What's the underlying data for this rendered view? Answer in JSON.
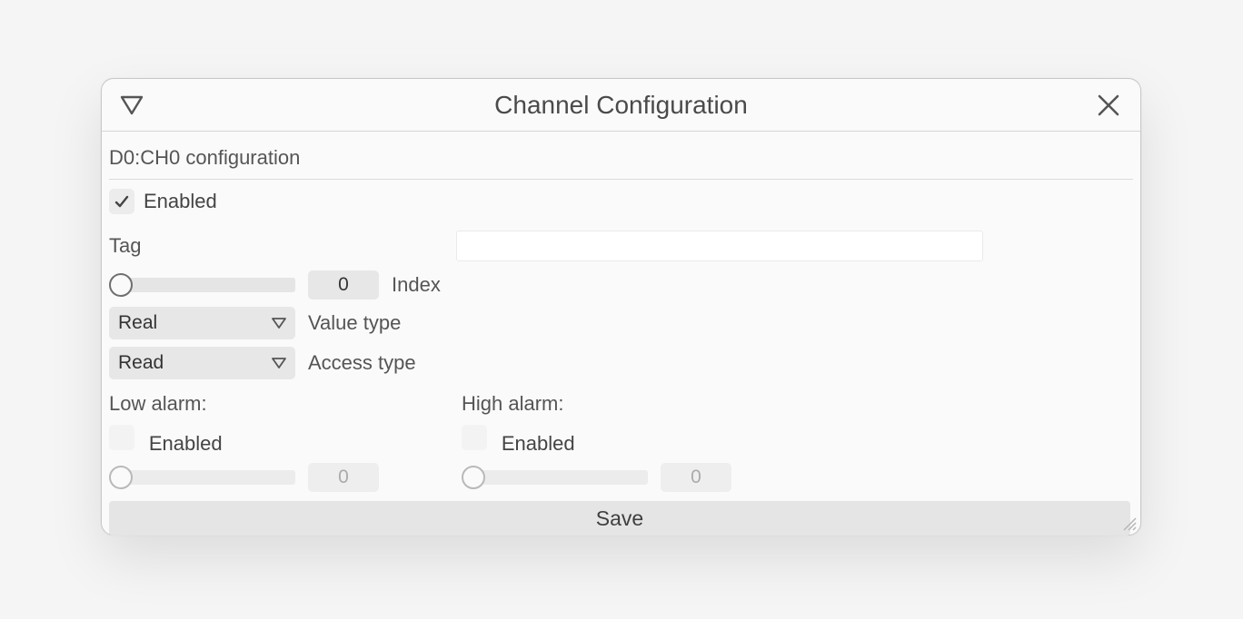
{
  "window": {
    "title": "Channel Configuration",
    "subtitle": "D0:CH0 configuration"
  },
  "enabled": {
    "label": "Enabled",
    "checked": true
  },
  "tag": {
    "label": "Tag",
    "value": ""
  },
  "index": {
    "value": "0",
    "label": "Index"
  },
  "value_type": {
    "selected": "Real",
    "label": "Value type"
  },
  "access_type": {
    "selected": "Read",
    "label": "Access type"
  },
  "low_alarm": {
    "header": "Low alarm:",
    "enabled_label": "Enabled",
    "enabled_checked": false,
    "value": "0"
  },
  "high_alarm": {
    "header": "High alarm:",
    "enabled_label": "Enabled",
    "enabled_checked": false,
    "value": "0"
  },
  "save_label": "Save"
}
